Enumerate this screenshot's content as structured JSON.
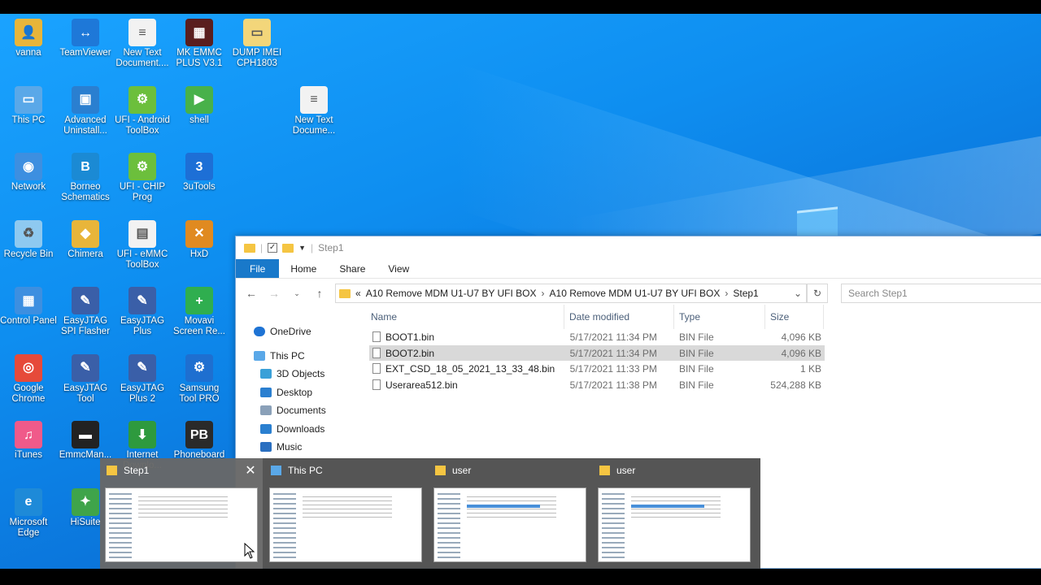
{
  "desktop": {
    "icons": [
      {
        "label": "vanna",
        "color": "#e8b53a",
        "glyph": "👤"
      },
      {
        "label": "TeamViewer",
        "color": "#1e78d8",
        "glyph": "↔"
      },
      {
        "label": "New Text Document....",
        "color": "#f2f2f2",
        "glyph": "≡"
      },
      {
        "label": "MK EMMC PLUS V3.1",
        "color": "#5a1e1e",
        "glyph": "▦"
      },
      {
        "label": "DUMP IMEI CPH1803",
        "color": "#f3d67a",
        "glyph": "▭"
      },
      {
        "label": "This PC",
        "color": "#5aa8e8",
        "glyph": "▭"
      },
      {
        "label": "Advanced Uninstall...",
        "color": "#2a7fd0",
        "glyph": "▣"
      },
      {
        "label": "UFI - Android ToolBox",
        "color": "#6cbf3c",
        "glyph": "⚙"
      },
      {
        "label": "shell",
        "color": "#48b14a",
        "glyph": "▶"
      },
      {
        "label": "New Text Docume...",
        "color": "#f2f2f2",
        "glyph": "≡"
      },
      {
        "label": "Network",
        "color": "#3d8fe0",
        "glyph": "◉"
      },
      {
        "label": "Borneo Schematics",
        "color": "#1b8ad4",
        "glyph": "B"
      },
      {
        "label": "UFI - CHIP Prog",
        "color": "#6cbf3c",
        "glyph": "⚙"
      },
      {
        "label": "3uTools",
        "color": "#1d6fd6",
        "glyph": "3"
      },
      {
        "label": "Recycle Bin",
        "color": "#8ec9f0",
        "glyph": "♻"
      },
      {
        "label": "Chimera",
        "color": "#e8b53a",
        "glyph": "◆"
      },
      {
        "label": "UFI - eMMC ToolBox",
        "color": "#f2f2f2",
        "glyph": "▤"
      },
      {
        "label": "HxD",
        "color": "#e08a20",
        "glyph": "✕"
      },
      {
        "label": "Control Panel",
        "color": "#3d8fe0",
        "glyph": "▦"
      },
      {
        "label": "EasyJTAG SPI Flasher",
        "color": "#3a5fa8",
        "glyph": "✎"
      },
      {
        "label": "EasyJTAG Plus",
        "color": "#3a5fa8",
        "glyph": "✎"
      },
      {
        "label": "Movavi Screen Re...",
        "color": "#2fae4f",
        "glyph": "+"
      },
      {
        "label": "Google Chrome",
        "color": "#e64a3a",
        "glyph": "◎"
      },
      {
        "label": "EasyJTAG Tool",
        "color": "#3a5fa8",
        "glyph": "✎"
      },
      {
        "label": "EasyJTAG Plus 2",
        "color": "#3a5fa8",
        "glyph": "✎"
      },
      {
        "label": "Samsung Tool PRO",
        "color": "#1e6fd0",
        "glyph": "⚙"
      },
      {
        "label": "iTunes",
        "color": "#f05a8a",
        "glyph": "♫"
      },
      {
        "label": "EmmcMan...",
        "color": "#222222",
        "glyph": "▬"
      },
      {
        "label": "Internet Downlo...",
        "color": "#2e9a3e",
        "glyph": "⬇"
      },
      {
        "label": "Phoneboard",
        "color": "#2a2a2a",
        "glyph": "PB"
      },
      {
        "label": "Microsoft Edge",
        "color": "#1e8ad8",
        "glyph": "e"
      },
      {
        "label": "HiSuite",
        "color": "#3fa44a",
        "glyph": "✦"
      }
    ]
  },
  "explorer": {
    "title": "Step1",
    "ribbon_tabs": [
      "File",
      "Home",
      "Share",
      "View"
    ],
    "address": {
      "prefix": "«",
      "crumbs": [
        "A10 Remove  MDM U1-U7 BY UFI BOX",
        "A10 Remove  MDM U1-U7 BY UFI BOX",
        "Step1"
      ]
    },
    "search_placeholder": "Search Step1",
    "nav": [
      "OneDrive",
      "This PC",
      "3D Objects",
      "Desktop",
      "Documents",
      "Downloads",
      "Music"
    ],
    "columns": [
      "Name",
      "Date modified",
      "Type",
      "Size"
    ],
    "files": [
      {
        "name": "BOOT1.bin",
        "date": "5/17/2021 11:34 PM",
        "type": "BIN File",
        "size": "4,096 KB"
      },
      {
        "name": "BOOT2.bin",
        "date": "5/17/2021 11:34 PM",
        "type": "BIN File",
        "size": "4,096 KB"
      },
      {
        "name": "EXT_CSD_18_05_2021_13_33_48.bin",
        "date": "5/17/2021 11:33 PM",
        "type": "BIN File",
        "size": "1 KB"
      },
      {
        "name": "Userarea512.bin",
        "date": "5/17/2021 11:38 PM",
        "type": "BIN File",
        "size": "524,288 KB"
      }
    ],
    "selected_index": 1
  },
  "taskbar_thumbs": [
    {
      "title": "Step1",
      "active": true
    },
    {
      "title": "This PC",
      "active": false
    },
    {
      "title": "user",
      "active": false
    },
    {
      "title": "user",
      "active": false
    }
  ]
}
